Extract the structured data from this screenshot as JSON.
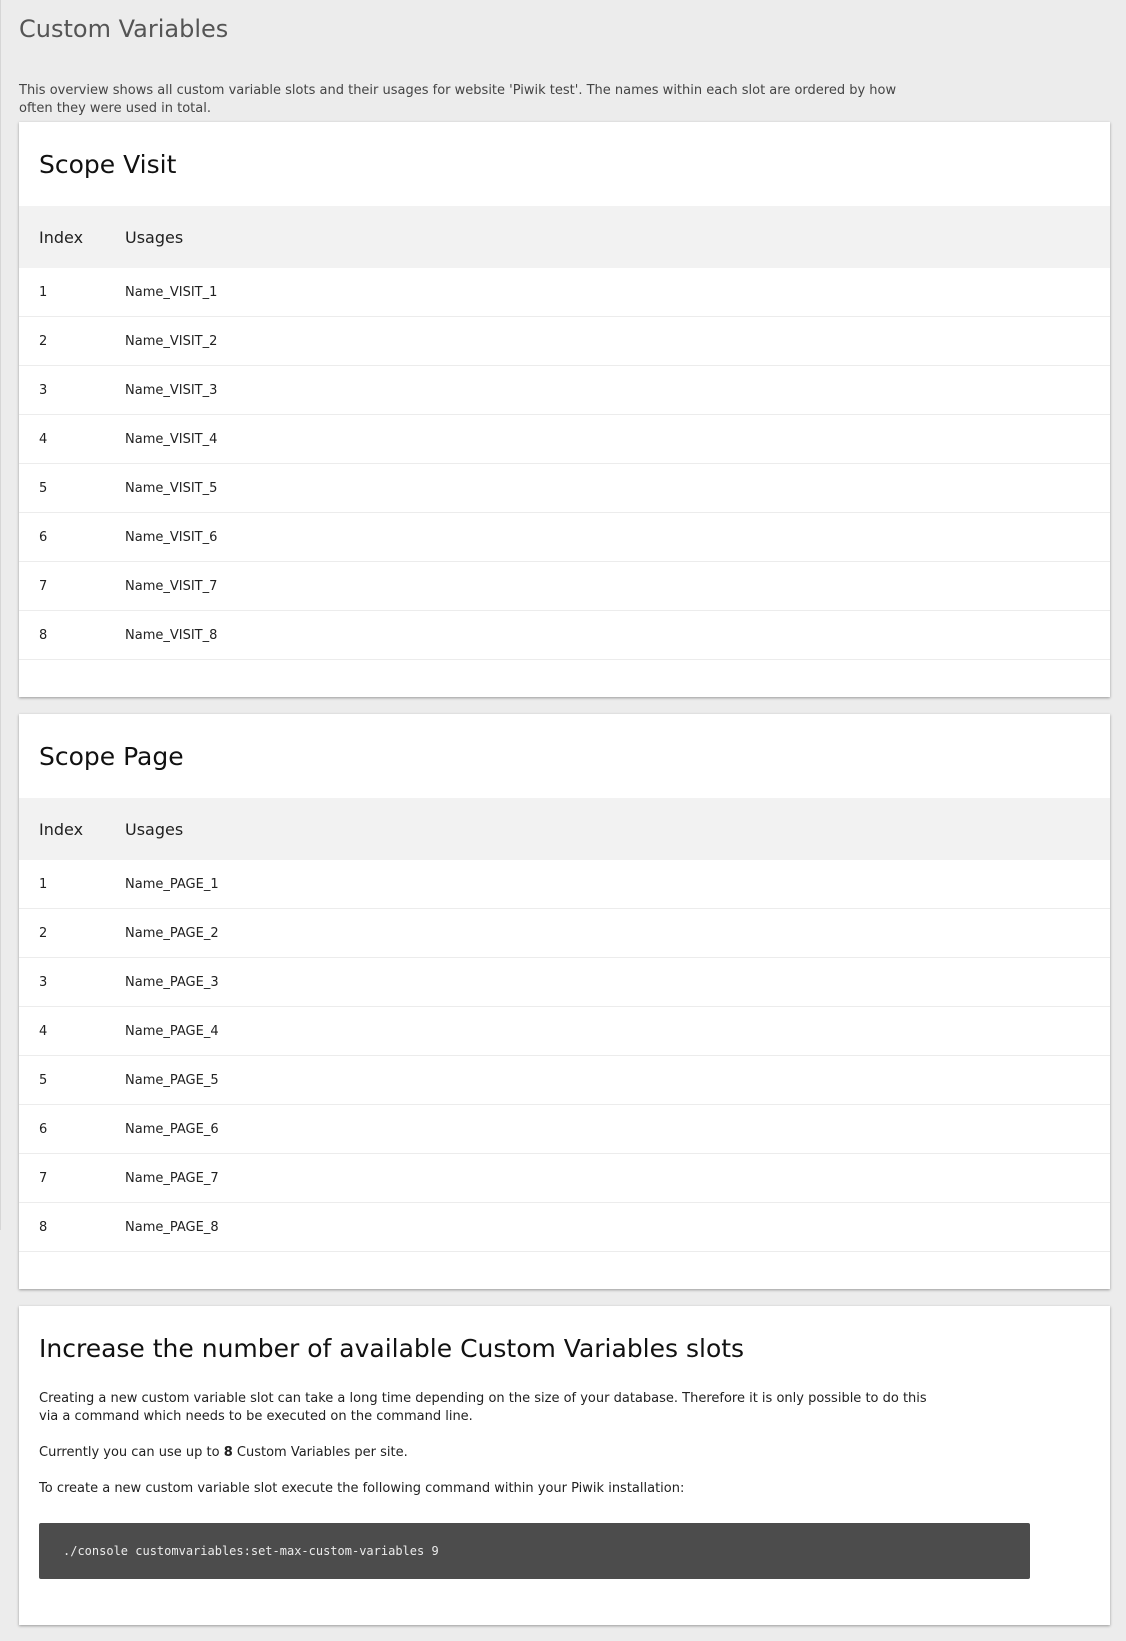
{
  "page": {
    "title": "Custom Variables",
    "intro": "This overview shows all custom variable slots and their usages for website 'Piwik test'. The names within each slot are ordered by how often they were used in total."
  },
  "scopes": [
    {
      "title": "Scope Visit",
      "headers": {
        "index": "Index",
        "usages": "Usages"
      },
      "rows": [
        {
          "index": "1",
          "usage": "Name_VISIT_1"
        },
        {
          "index": "2",
          "usage": "Name_VISIT_2"
        },
        {
          "index": "3",
          "usage": "Name_VISIT_3"
        },
        {
          "index": "4",
          "usage": "Name_VISIT_4"
        },
        {
          "index": "5",
          "usage": "Name_VISIT_5"
        },
        {
          "index": "6",
          "usage": "Name_VISIT_6"
        },
        {
          "index": "7",
          "usage": "Name_VISIT_7"
        },
        {
          "index": "8",
          "usage": "Name_VISIT_8"
        }
      ]
    },
    {
      "title": "Scope Page",
      "headers": {
        "index": "Index",
        "usages": "Usages"
      },
      "rows": [
        {
          "index": "1",
          "usage": "Name_PAGE_1"
        },
        {
          "index": "2",
          "usage": "Name_PAGE_2"
        },
        {
          "index": "3",
          "usage": "Name_PAGE_3"
        },
        {
          "index": "4",
          "usage": "Name_PAGE_4"
        },
        {
          "index": "5",
          "usage": "Name_PAGE_5"
        },
        {
          "index": "6",
          "usage": "Name_PAGE_6"
        },
        {
          "index": "7",
          "usage": "Name_PAGE_7"
        },
        {
          "index": "8",
          "usage": "Name_PAGE_8"
        }
      ]
    }
  ],
  "increase": {
    "title": "Increase the number of available Custom Variables slots",
    "para1": "Creating a new custom variable slot can take a long time depending on the size of your database. Therefore it is only possible to do this via a command which needs to be executed on the command line.",
    "para2_prefix": "Currently you can use up to ",
    "para2_count": "8",
    "para2_suffix": " Custom Variables per site.",
    "para3": "To create a new custom variable slot execute the following command within your Piwik installation:",
    "command": "./console customvariables:set-max-custom-variables 9"
  }
}
